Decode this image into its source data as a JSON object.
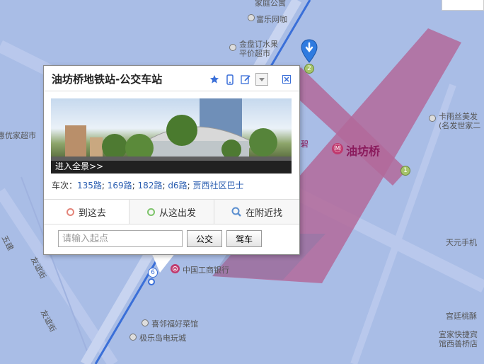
{
  "colors": {
    "map_bg": "#a9bde6",
    "metro_line": "#b36a9a",
    "road": "#c8d4f0",
    "accent_link": "#2a5db0"
  },
  "map": {
    "labels": [
      {
        "text": "家庭公寓",
        "cls": "poi"
      },
      {
        "text": "富乐网咖",
        "cls": "poi"
      },
      {
        "text": "金盘订水果",
        "cls": "poi"
      },
      {
        "text": "平价超市",
        "cls": "poi"
      },
      {
        "text": "卡雨丝美发",
        "cls": "poi"
      },
      {
        "text": "(名发世家二",
        "cls": "poi"
      },
      {
        "text": "惠优家超市",
        "cls": "poi"
      },
      {
        "text": "天元手机",
        "cls": "poi"
      },
      {
        "text": "中国工商银行",
        "cls": "poi"
      },
      {
        "text": "喜邻福好菜馆",
        "cls": "poi"
      },
      {
        "text": "极乐岛电玩城",
        "cls": "poi"
      },
      {
        "text": "宫廷桃酥",
        "cls": "poi"
      },
      {
        "text": "宜家快捷宾",
        "cls": "poi"
      },
      {
        "text": "馆西善桥店",
        "cls": "poi"
      },
      {
        "text": "友谊街",
        "cls": "road"
      },
      {
        "text": "友谊街",
        "cls": "road"
      },
      {
        "text": "五建",
        "cls": "road"
      },
      {
        "text": "碧",
        "cls": "road"
      }
    ],
    "station_label": "油坊桥",
    "metro_icon": "metro-icon",
    "exit_badges": [
      "2",
      "1",
      "6"
    ]
  },
  "popup": {
    "title": "油坊桥地铁站-公交车站",
    "tools": [
      "star-icon",
      "phone-icon",
      "edit-icon",
      "dropdown-icon",
      "close-icon"
    ],
    "photo_link": "进入全景>>",
    "routes_label": "车次：",
    "routes": [
      "135路",
      "169路",
      "182路",
      "d6路",
      "贾西社区巴士"
    ],
    "tabs": [
      {
        "label": "到这去",
        "icon": "destination-ring-icon",
        "color": "#e3857a"
      },
      {
        "label": "从这出发",
        "icon": "origin-ring-icon",
        "color": "#7ec46b"
      },
      {
        "label": "在附近找",
        "icon": "search-nearby-icon",
        "color": "#5b8fd0"
      }
    ],
    "input_placeholder": "请输入起点",
    "bus_button": "公交",
    "drive_button": "驾车"
  }
}
